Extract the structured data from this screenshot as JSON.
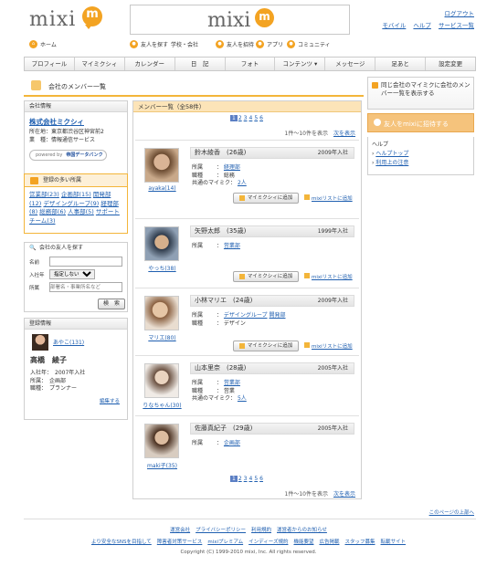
{
  "header": {
    "logo_text": "mixi",
    "logo_mark": "m",
    "top_link_logout": "ログアウト",
    "top_links": [
      "モバイル",
      "ヘルプ",
      "サービス一覧"
    ]
  },
  "subnav": {
    "home": "ホーム",
    "find_friends": "友人を探す",
    "find_friends_sub": "学校・会社",
    "invite": "友人を招待",
    "apps": "アプリ",
    "community": "コミュニティ"
  },
  "mainnav": [
    "プロフィール",
    "マイミクシィ",
    "カレンダー",
    "日　記",
    "フォト",
    "コンテンツ ▾",
    "メッセージ",
    "足あと",
    "設定変更"
  ],
  "page_title": "会社のメンバー一覧",
  "company": {
    "header": "会社情報",
    "name": "株式会社ミクシィ",
    "address": "所在地：東京都渋谷区神宮前2",
    "industry": "業　種：情報通信サービス",
    "powered": "powered by",
    "powered_brand": "帝国データバンク"
  },
  "departments": {
    "header": "登録の多い所属",
    "items": [
      "営業部(23)",
      "企画部(15)",
      "開発部(12)",
      "デザイングループ(9)",
      "経理部(8)",
      "総務部(6)",
      "人事部(5)",
      "サポートチーム(3)"
    ]
  },
  "search": {
    "header": "会社の友人を探す",
    "name_label": "名前",
    "year_label": "入社年",
    "year_value": "指定しない",
    "dept_label": "所属",
    "dept_placeholder": "部署名・事業所名など",
    "button": "検　索"
  },
  "reg": {
    "header": "登録情報",
    "nick": "あやこ(131)",
    "name": "高橋　綾子",
    "year": "入社年：　2007年入社",
    "dept": "所属：　企画部",
    "role": "職種：　プランナー",
    "edit": "編集する"
  },
  "list": {
    "header": "メンバー一覧（全58件）",
    "pages": [
      "1",
      "2",
      "3",
      "4",
      "5",
      "6"
    ],
    "current_page": "1",
    "count": "1件～10件を表示",
    "next": "次を表示",
    "add_button": "マイミクシィに追加",
    "mylist": "mixiリストに追加"
  },
  "members": [
    {
      "name": "鈴木綾香　(26歳)",
      "year": "2009年入社",
      "nick": "ayaka(14)",
      "dept": "経理部",
      "role": "総務",
      "common": "2人",
      "photo": "#8a6a4a"
    },
    {
      "name": "矢野太郎　(35歳)",
      "year": "1999年入社",
      "nick": "やっち(38)",
      "dept": "営業部",
      "role": "",
      "common": "",
      "photo": "#6a7a8a"
    },
    {
      "name": "小林マリエ　(24歳)",
      "year": "2009年入社",
      "nick": "マリエ(80)",
      "dept": "デザイングループ",
      "dept2": "開発部",
      "role": "デザイン",
      "common": "",
      "photo": "#b09070"
    },
    {
      "name": "山本里奈　(28歳)",
      "year": "2005年入社",
      "nick": "りなちゃん(30)",
      "dept": "営業部",
      "role": "営業",
      "common": "5人",
      "photo": "#a08878"
    },
    {
      "name": "佐藤真紀子　(29歳)",
      "year": "2005年入社",
      "nick": "maki子(35)",
      "dept": "企画部",
      "role": "",
      "common": "",
      "photo": "#7a6050"
    }
  ],
  "labels": {
    "dept": "所属",
    "role": "職種",
    "common": "共通のマイミク"
  },
  "right": {
    "same_company": "同じ会社のマイミクに会社のメンバー一覧を表示する",
    "invite": "友人をmixiに招待する",
    "help_header": "ヘルプ",
    "help_items": [
      "ヘルプトップ",
      "利用上の注意"
    ]
  },
  "footer": {
    "page_top": "このページの上部へ",
    "links1": [
      "運営会社",
      "プライバシーポリシー",
      "利用規約",
      "運営者からのお知らせ"
    ],
    "links2": [
      "より安全なSNSを目指して",
      "障害者対策サービス",
      "mixiプレミアム",
      "インディーズ規約",
      "機能要望",
      "広告掲載",
      "スタッフ募集",
      "転載サイト"
    ],
    "copyright": "Copyright (C) 1999-2010 mixi, Inc. All rights reserved."
  }
}
